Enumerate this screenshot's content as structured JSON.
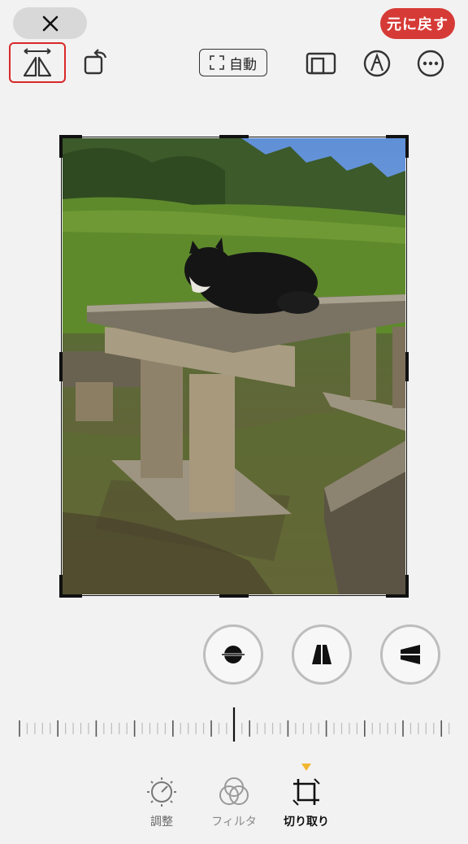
{
  "header": {
    "close_icon": "close-icon",
    "revert_label": "元に戻す",
    "flip_icon": "flip-horizontal-icon",
    "rotate_icon": "rotate-icon",
    "auto_label": "自動",
    "aspect_icon": "aspect-ratio-icon",
    "markup_icon": "markup-pen-icon",
    "more_icon": "more-icon"
  },
  "colors": {
    "accent_red": "#d63a36",
    "highlight_red": "#d82828",
    "indicator_yellow": "#f2b632",
    "background": "#f2f2f2"
  },
  "perspective": [
    {
      "name": "straighten",
      "icon": "straighten-icon"
    },
    {
      "name": "vertical",
      "icon": "vertical-perspective-icon"
    },
    {
      "name": "horizontal",
      "icon": "horizontal-perspective-icon"
    }
  ],
  "dial": {
    "value": 0
  },
  "tabs": [
    {
      "label": "調整",
      "icon": "adjust-icon",
      "selected": false
    },
    {
      "label": "フィルタ",
      "icon": "filter-icon",
      "selected": false
    },
    {
      "label": "切り取り",
      "icon": "crop-icon",
      "selected": true
    }
  ]
}
